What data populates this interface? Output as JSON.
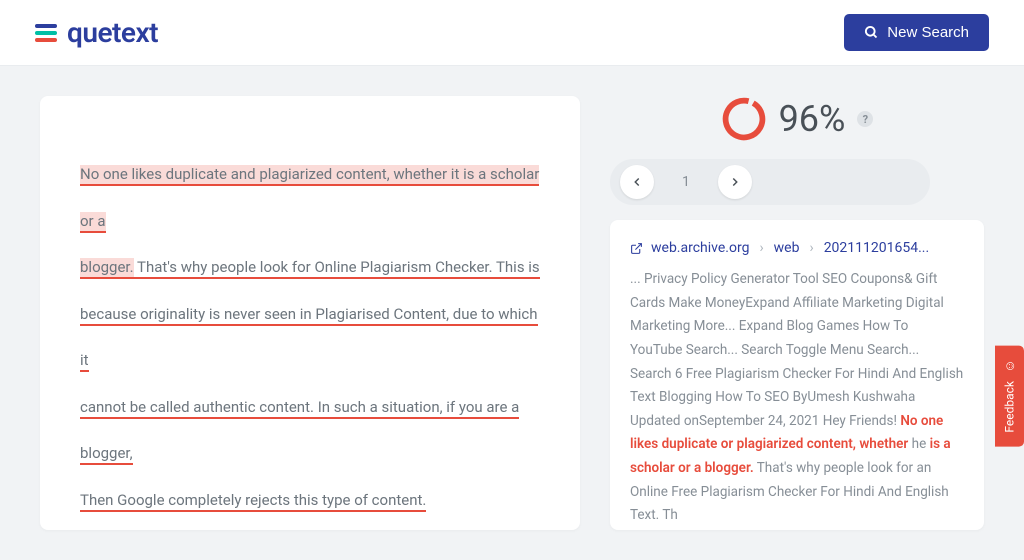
{
  "header": {
    "logo_text": "quetext",
    "new_search_label": "New Search"
  },
  "content": {
    "seg1": "No one likes duplicate and plagiarized content, whether it is a scholar or a",
    "seg2": "blogger.",
    "seg3": " That's why people look for Online Plagiarism Checker.",
    "seg4": " This is",
    "seg5": "because originality is never seen in Plagiarised Content, due to which it",
    "seg6": "cannot be called authentic content.",
    "seg7": " In such a situation, if you are a blogger,",
    "seg8": "Then Google completely rejects this type of content."
  },
  "score": {
    "percent": "96%",
    "help": "?"
  },
  "pagination": {
    "current": "1"
  },
  "source": {
    "domain": "web.archive.org",
    "path1": "web",
    "path2": "202111201654...",
    "snippet_pre": "... Privacy Policy Generator Tool SEO Coupons& Gift Cards Make MoneyExpand Affiliate Marketing Digital Marketing More... Expand Blog Games How To YouTube Search... Search Toggle Menu Search... Search 6 Free Plagiarism Checker For Hindi And English Text Blogging How To SEO ByUmesh Kushwaha Updated onSeptember 24, 2021 Hey Friends! ",
    "match1": "No one likes duplicate or plagiarized content, whether",
    "between1": " he ",
    "match2": "is a scholar or a blogger.",
    "snippet_post": " That's why people look for an Online Free Plagiarism Checker For Hindi And English Text. Th"
  },
  "feedback": {
    "label": "Feedback"
  }
}
